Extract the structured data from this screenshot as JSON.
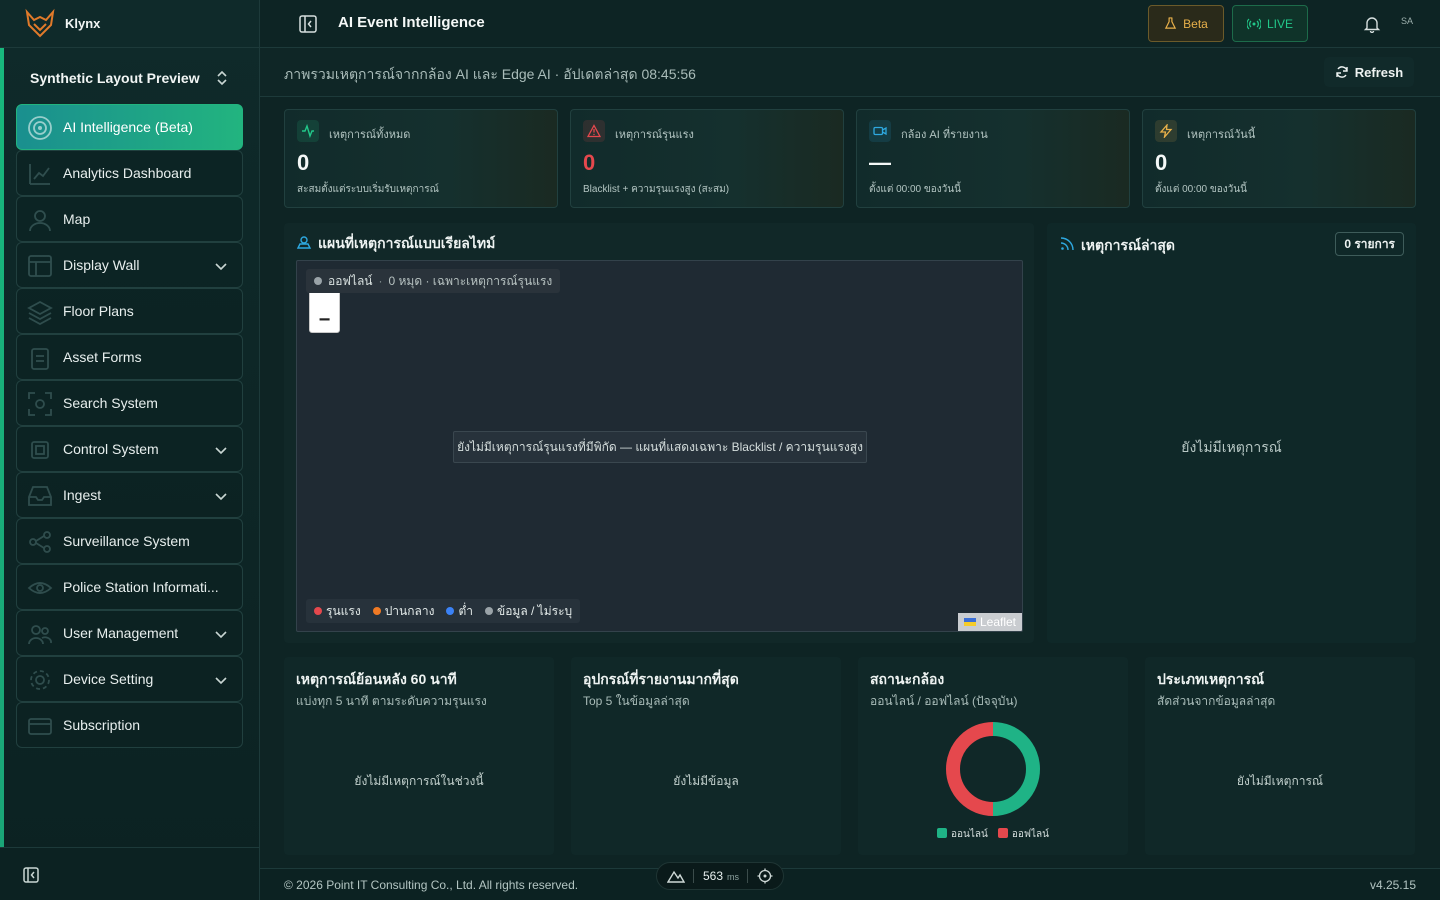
{
  "brand": {
    "name": "Klynx"
  },
  "workspace": {
    "label": "Synthetic Layout Preview"
  },
  "sidebar": {
    "items": [
      {
        "label": "AI Intelligence (Beta)",
        "active": true,
        "icon": "radar-icon",
        "expandable": false
      },
      {
        "label": "Analytics Dashboard",
        "icon": "dashboard-icon",
        "expandable": false
      },
      {
        "label": "Map",
        "icon": "user-icon",
        "expandable": false
      },
      {
        "label": "Display Wall",
        "icon": "layout-icon",
        "expandable": true
      },
      {
        "label": "Floor Plans",
        "icon": "layers-icon",
        "expandable": false
      },
      {
        "label": "Asset Forms",
        "icon": "clipboard-icon",
        "expandable": false
      },
      {
        "label": "Search System",
        "icon": "scan-icon",
        "expandable": false
      },
      {
        "label": "Control System",
        "icon": "cpu-icon",
        "expandable": true
      },
      {
        "label": "Ingest",
        "icon": "inbox-icon",
        "expandable": true
      },
      {
        "label": "Surveillance System",
        "icon": "network-icon",
        "expandable": false
      },
      {
        "label": "Police Station Informati...",
        "icon": "eye-icon",
        "expandable": false
      },
      {
        "label": "User Management",
        "icon": "users-icon",
        "expandable": true
      },
      {
        "label": "Device Setting",
        "icon": "gear-icon",
        "expandable": true
      },
      {
        "label": "Subscription",
        "icon": "card-icon",
        "expandable": false
      }
    ]
  },
  "topbar": {
    "title": "AI Event Intelligence",
    "beta_label": "Beta",
    "live_label": "LIVE",
    "avatar": "SA"
  },
  "subheader": {
    "description": "ภาพรวมเหตุการณ์จากกล้อง AI และ Edge AI · อัปเดตล่าสุด 08:45:56",
    "refresh_label": "Refresh"
  },
  "stats": [
    {
      "label": "เหตุการณ์ทั้งหมด",
      "value": "0",
      "sub": "สะสมตั้งแต่ระบบเริ่มรับเหตุการณ์",
      "icon": "activity-icon",
      "color": "#22c88a"
    },
    {
      "label": "เหตุการณ์รุนแรง",
      "value": "0",
      "sub": "Blacklist + ความรุนแรงสูง (สะสม)",
      "icon": "alert-triangle-icon",
      "color": "#e5484d"
    },
    {
      "label": "กล้อง AI ที่รายงาน",
      "value": "—",
      "sub": "ตั้งแต่ 00:00 ของวันนี้",
      "icon": "video-icon",
      "color": "#2ea8e0"
    },
    {
      "label": "เหตุการณ์วันนี้",
      "value": "0",
      "sub": "ตั้งแต่ 00:00 ของวันนี้",
      "icon": "bolt-icon",
      "color": "#e8b04a"
    }
  ],
  "map_panel": {
    "title": "แผนที่เหตุการณ์แบบเรียลไทม์",
    "status_online": "ออฟไลน์",
    "status_detail": "0 หมุด · เฉพาะเหตุการณ์รุนแรง",
    "zoom_out": "−",
    "empty_message": "ยังไม่มีเหตุการณ์รุนแรงที่มีพิกัด — แผนที่แสดงเฉพาะ Blacklist / ความรุนแรงสูง",
    "legend": [
      {
        "label": "รุนแรง",
        "color": "#e5484d"
      },
      {
        "label": "ปานกลาง",
        "color": "#f07a24"
      },
      {
        "label": "ต่ำ",
        "color": "#3b82f6"
      },
      {
        "label": "ข้อมูล / ไม่ระบุ",
        "color": "#9aa3a8"
      }
    ],
    "attribution": "Leaflet"
  },
  "events_panel": {
    "title": "เหตุการณ์ล่าสุด",
    "count": "0 รายการ",
    "empty": "ยังไม่มีเหตุการณ์"
  },
  "cards": [
    {
      "title": "เหตุการณ์ย้อนหลัง 60 นาที",
      "sub": "แบ่งทุก 5 นาที ตามระดับความรุนแรง",
      "empty": "ยังไม่มีเหตุการณ์ในช่วงนี้"
    },
    {
      "title": "อุปกรณ์ที่รายงานมากที่สุด",
      "sub": "Top 5 ในข้อมูลล่าสุด",
      "empty": "ยังไม่มีข้อมูล"
    },
    {
      "title": "สถานะกล้อง",
      "sub": "ออนไลน์ / ออฟไลน์ (ปัจจุบัน)",
      "legend_online": "ออนไลน์",
      "legend_offline": "ออฟไลน์"
    },
    {
      "title": "ประเภทเหตุการณ์",
      "sub": "สัดส่วนจากข้อมูลล่าสุด",
      "empty": "ยังไม่มีเหตุการณ์"
    }
  ],
  "chart_data": {
    "type": "pie",
    "categories": [
      "ออนไลน์",
      "ออฟไลน์"
    ],
    "values": [
      50,
      50
    ],
    "colors": [
      "#1fb386",
      "#e5484d"
    ],
    "title": "สถานะกล้อง"
  },
  "footer": {
    "copyright": "© 2026 Point IT Consulting Co., Ltd. All rights reserved.",
    "version": "v4.25.15",
    "latency": "563",
    "latency_unit": "ms"
  }
}
